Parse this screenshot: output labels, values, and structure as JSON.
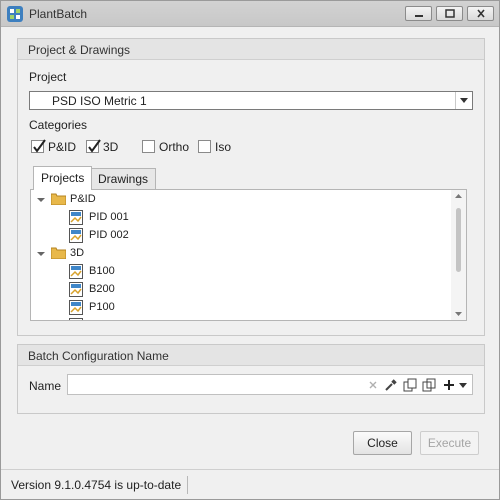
{
  "window": {
    "title": "PlantBatch"
  },
  "project_group": {
    "header": "Project & Drawings",
    "project_label": "Project",
    "project_value": "PSD ISO Metric 1",
    "categories_label": "Categories",
    "categories": [
      {
        "label": "P&ID",
        "checked": true
      },
      {
        "label": "3D",
        "checked": true
      },
      {
        "label": "Ortho",
        "checked": false
      },
      {
        "label": "Iso",
        "checked": false
      }
    ],
    "tabs": [
      {
        "label": "Projects",
        "active": true
      },
      {
        "label": "Drawings",
        "active": false
      }
    ],
    "tree": [
      {
        "label": "P&ID",
        "type": "folder",
        "expanded": true
      },
      {
        "label": "PID 001",
        "type": "drawing"
      },
      {
        "label": "PID 002",
        "type": "drawing"
      },
      {
        "label": "3D",
        "type": "folder",
        "expanded": true
      },
      {
        "label": "B100",
        "type": "drawing"
      },
      {
        "label": "B200",
        "type": "drawing"
      },
      {
        "label": "P100",
        "type": "drawing"
      }
    ]
  },
  "batch_group": {
    "header": "Batch Configuration Name",
    "name_label": "Name",
    "name_value": ""
  },
  "buttons": {
    "close": "Close",
    "execute": "Execute"
  },
  "status": {
    "text": "Version 9.1.0.4754 is up-to-date"
  }
}
